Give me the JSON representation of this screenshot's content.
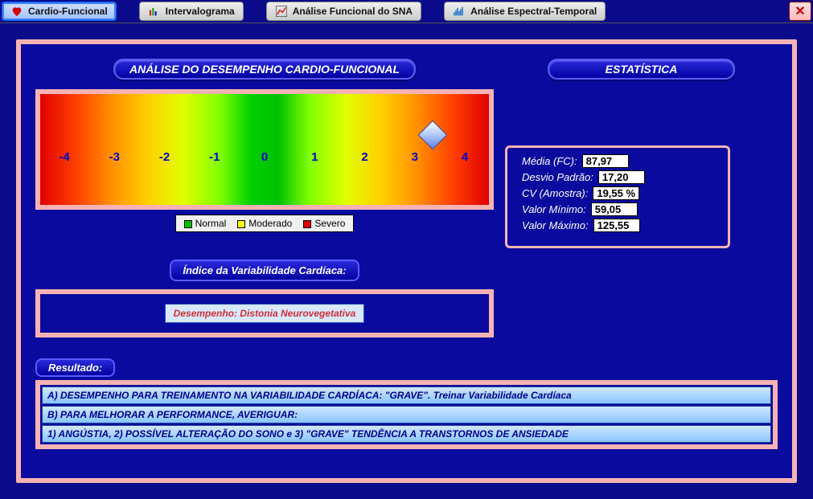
{
  "toolbar": {
    "tabs": [
      {
        "label": "Cardio-Funcional",
        "active": true,
        "icon": "heart"
      },
      {
        "label": "Intervalograma",
        "active": false,
        "icon": "bars"
      },
      {
        "label": "Análise Funcional do SNA",
        "active": false,
        "icon": "chart"
      },
      {
        "label": "Análise Espectral-Temporal",
        "active": false,
        "icon": "spectrum"
      }
    ]
  },
  "left_panel": {
    "header": "ANÁLISE DO DESEMPENHO CARDIO-FUNCIONAL",
    "gauge": {
      "ticks": [
        "-4",
        "-3",
        "-2",
        "-1",
        "0",
        "1",
        "2",
        "3",
        "4"
      ],
      "marker_value": 3,
      "legend": [
        {
          "label": "Normal",
          "color": "#00c000"
        },
        {
          "label": "Moderado",
          "color": "#ffff00"
        },
        {
          "label": "Severo",
          "color": "#e00000"
        }
      ]
    },
    "index_title": "Índice da Variabilidade Cardíaca:",
    "desempenho": "Desempenho: Distonia Neurovegetativa"
  },
  "right_panel": {
    "header": "ESTATÍSTICA",
    "stats": [
      {
        "label": "Média (FC):",
        "value": "87,97"
      },
      {
        "label": "Desvio Padrão:",
        "value": "17,20"
      },
      {
        "label": "CV (Amostra):",
        "value": "19,55 %"
      },
      {
        "label": "Valor Mínimo:",
        "value": "59,05"
      },
      {
        "label": "Valor Máximo:",
        "value": "125,55"
      }
    ]
  },
  "resultado": {
    "header": "Resultado:",
    "lines": [
      "A) DESEMPENHO PARA TREINAMENTO NA VARIABILIDADE CARDÍACA: \"GRAVE\". Treinar Variabilidade Cardíaca",
      "B) PARA MELHORAR A PERFORMANCE, AVERIGUAR:",
      "1) ANGÚSTIA, 2) POSSÍVEL ALTERAÇÃO DO SONO e 3) \"GRAVE\" TENDÊNCIA A TRANSTORNOS DE ANSIEDADE"
    ]
  },
  "chart_data": {
    "type": "bar",
    "categories": [
      "-4",
      "-3",
      "-2",
      "-1",
      "0",
      "1",
      "2",
      "3",
      "4"
    ],
    "marker_value": 3,
    "title": "ANÁLISE DO DESEMPENHO CARDIO-FUNCIONAL",
    "legend": [
      "Normal",
      "Moderado",
      "Severo"
    ],
    "xlim": [
      -4,
      4
    ]
  }
}
